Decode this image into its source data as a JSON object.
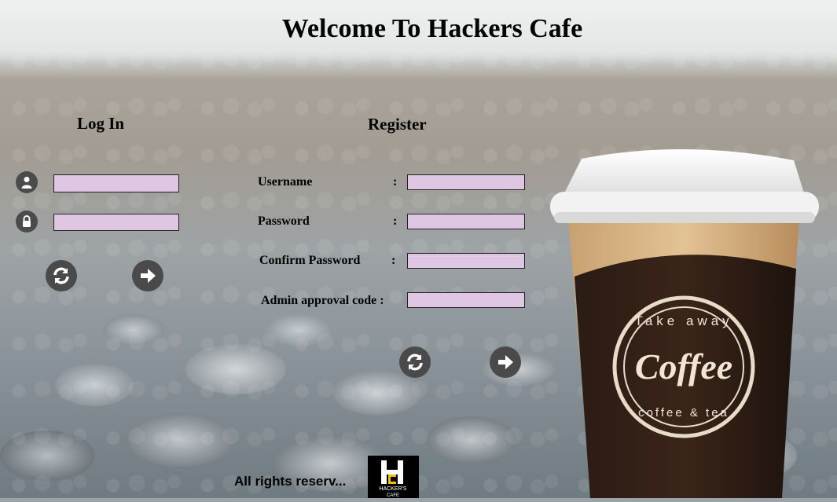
{
  "header": {
    "title": "Welcome To Hackers Cafe"
  },
  "login": {
    "title": "Log In",
    "username_value": "",
    "password_value": ""
  },
  "register": {
    "title": "Register",
    "fields": [
      {
        "label": "Username",
        "colon": ":",
        "value": ""
      },
      {
        "label": "Password",
        "colon": ":",
        "value": ""
      },
      {
        "label": "Confirm Password",
        "colon": ":",
        "value": ""
      },
      {
        "label": "Admin approval code :",
        "value": ""
      }
    ]
  },
  "cup": {
    "top_text": "Take away",
    "brand": "Coffee",
    "bottom_text": "coffee & tea"
  },
  "footer": {
    "text": "All rights reserv...",
    "logo_line1": "HACKER'S",
    "logo_line2": "CAFE"
  },
  "icons": {
    "user": "user-icon",
    "lock": "lock-icon",
    "reset": "refresh-icon",
    "submit": "arrow-right-icon"
  },
  "colors": {
    "field_bg": "#dfc6e2",
    "icon_bg": "#4a4a4a"
  }
}
